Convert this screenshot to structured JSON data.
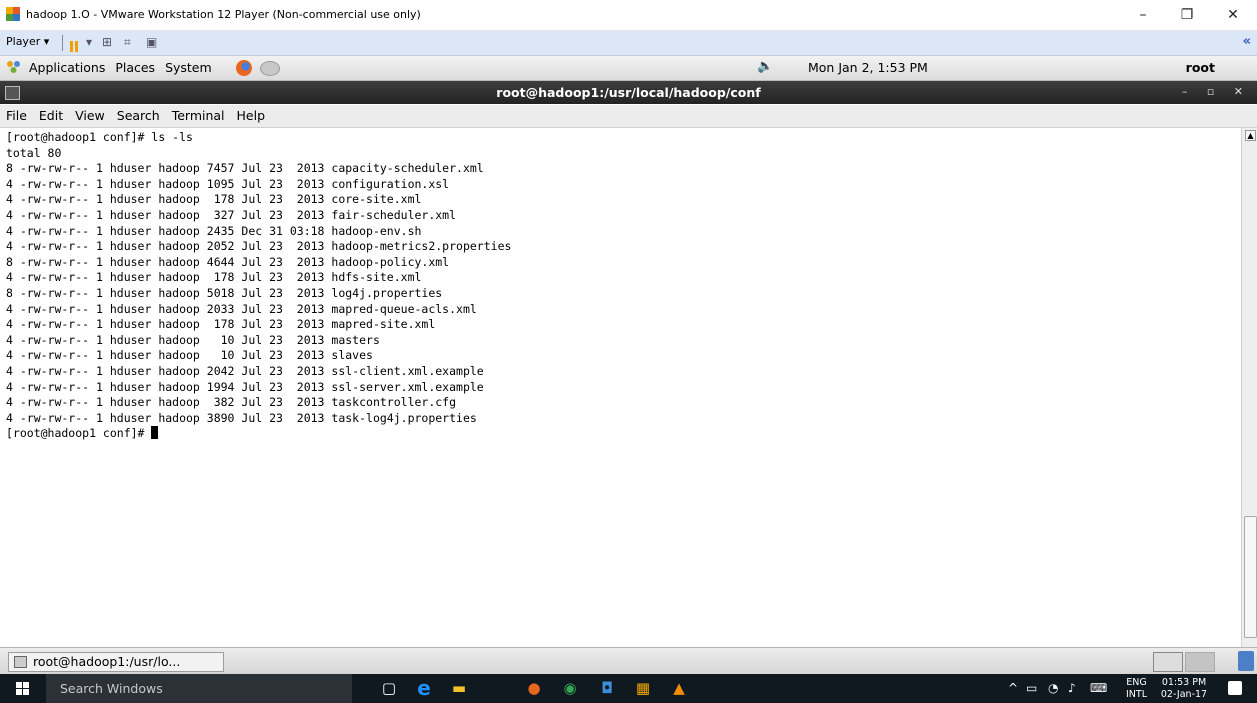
{
  "vmware": {
    "title": "hadoop 1.O - VMware Workstation 12 Player (Non-commercial use only)",
    "player_menu": "Player ▾",
    "controls": {
      "minimize": "–",
      "restore": "❐",
      "close": "✕"
    },
    "collapse": "«"
  },
  "gnome_panel": {
    "menus": [
      "Applications",
      "Places",
      "System"
    ],
    "clock": "Mon Jan  2,  1:53 PM",
    "user": "root",
    "volume_icon": "🔈"
  },
  "terminal": {
    "title": "root@hadoop1:/usr/local/hadoop/conf",
    "window_controls": "– ▫ ✕",
    "menu": [
      "File",
      "Edit",
      "View",
      "Search",
      "Terminal",
      "Help"
    ],
    "lines": [
      "[root@hadoop1 conf]# ls -ls",
      "total 80",
      "8 -rw-rw-r-- 1 hduser hadoop 7457 Jul 23  2013 capacity-scheduler.xml",
      "4 -rw-rw-r-- 1 hduser hadoop 1095 Jul 23  2013 configuration.xsl",
      "4 -rw-rw-r-- 1 hduser hadoop  178 Jul 23  2013 core-site.xml",
      "4 -rw-rw-r-- 1 hduser hadoop  327 Jul 23  2013 fair-scheduler.xml",
      "4 -rw-rw-r-- 1 hduser hadoop 2435 Dec 31 03:18 hadoop-env.sh",
      "4 -rw-rw-r-- 1 hduser hadoop 2052 Jul 23  2013 hadoop-metrics2.properties",
      "8 -rw-rw-r-- 1 hduser hadoop 4644 Jul 23  2013 hadoop-policy.xml",
      "4 -rw-rw-r-- 1 hduser hadoop  178 Jul 23  2013 hdfs-site.xml",
      "8 -rw-rw-r-- 1 hduser hadoop 5018 Jul 23  2013 log4j.properties",
      "4 -rw-rw-r-- 1 hduser hadoop 2033 Jul 23  2013 mapred-queue-acls.xml",
      "4 -rw-rw-r-- 1 hduser hadoop  178 Jul 23  2013 mapred-site.xml",
      "4 -rw-rw-r-- 1 hduser hadoop   10 Jul 23  2013 masters",
      "4 -rw-rw-r-- 1 hduser hadoop   10 Jul 23  2013 slaves",
      "4 -rw-rw-r-- 1 hduser hadoop 2042 Jul 23  2013 ssl-client.xml.example",
      "4 -rw-rw-r-- 1 hduser hadoop 1994 Jul 23  2013 ssl-server.xml.example",
      "4 -rw-rw-r-- 1 hduser hadoop  382 Jul 23  2013 taskcontroller.cfg",
      "4 -rw-rw-r-- 1 hduser hadoop 3890 Jul 23  2013 task-log4j.properties"
    ],
    "prompt": "[root@hadoop1 conf]# "
  },
  "gnome_bottom": {
    "task_label": "root@hadoop1:/usr/lo..."
  },
  "windows_taskbar": {
    "search_placeholder": "Search Windows",
    "tray_arrow": "^",
    "lang_top": "ENG",
    "lang_bottom": "INTL",
    "time": "01:53 PM",
    "date": "02-Jan-17",
    "colors": {
      "edge": "#1e90ff",
      "explorer": "#f2c12e",
      "firefox": "#e8661e",
      "chrome": "#34a853",
      "vlc": "#f28c00"
    }
  }
}
